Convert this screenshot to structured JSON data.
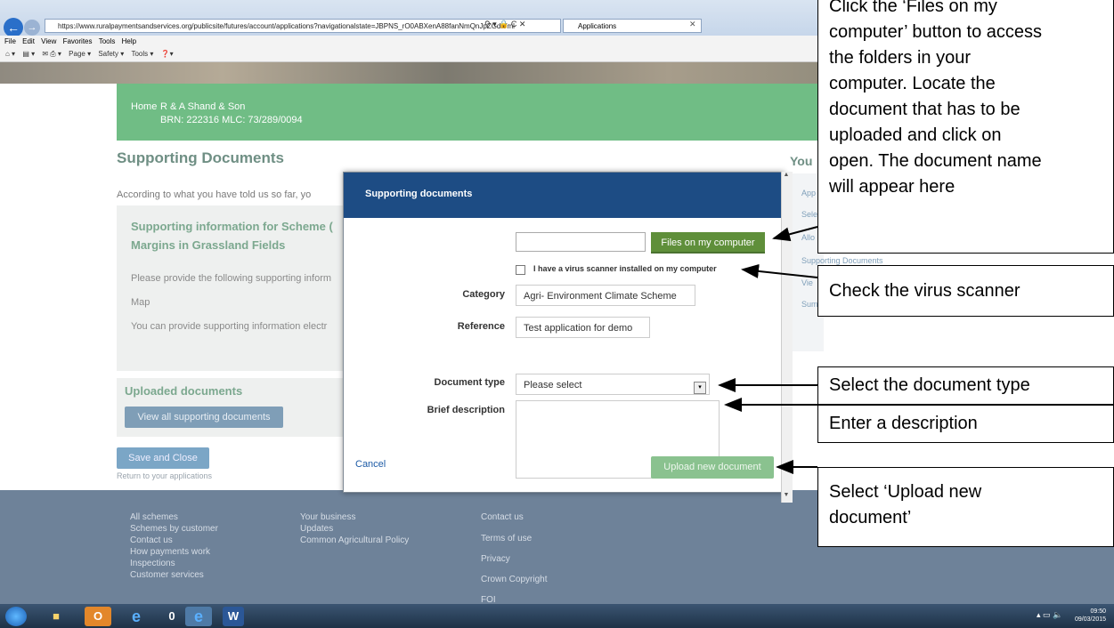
{
  "browser": {
    "url": "https://www.ruralpaymentsandservices.org/publicsite/futures/account/applications?navigationalstate=JBPNS_rO0ABXenA88fanNmQnJpZGdlVml",
    "tab_title": "Applications",
    "menu": [
      "File",
      "Edit",
      "View",
      "Favorites",
      "Tools",
      "Help"
    ],
    "commands": [
      "Page ▾",
      "Safety ▾",
      "Tools ▾"
    ]
  },
  "nav": {
    "home": "Home",
    "company": "R & A Shand & Son",
    "brn": "BRN: 222316 MLC: 73/289/0094"
  },
  "page": {
    "title": "Supporting Documents",
    "intro": "According to what you have told us so far, yo",
    "panel_title": "Supporting information for Scheme (\nMargins in Grassland Fields",
    "panel_p1": "Please provide the following supporting inform",
    "panel_map": "Map",
    "panel_p2": "You can provide supporting information electr",
    "uploaded_title": "Uploaded documents",
    "view_all": "View all supporting documents",
    "save_close": "Save and Close",
    "return": "Return to your applications"
  },
  "sidebar": {
    "title": "You",
    "links": [
      "App",
      "Sele",
      "Allo",
      "Supporting Documents",
      "Vie",
      "Sum"
    ]
  },
  "footer": {
    "col1": [
      "All schemes",
      "Schemes by customer",
      "Contact us",
      "How payments work",
      "Inspections",
      "Customer services"
    ],
    "col2": [
      "Your business",
      "Updates",
      "Common Agricultural Policy"
    ],
    "col3": [
      "Contact us",
      "Terms of use",
      "Privacy",
      "Crown Copyright",
      "FOI"
    ]
  },
  "modal": {
    "title": "Supporting documents",
    "files_button": "Files on my computer",
    "virus_label": "I have a virus scanner installed on my computer",
    "category_label": "Category",
    "category_value": "Agri- Environment Climate Scheme",
    "reference_label": "Reference",
    "reference_value": "Test application for demo",
    "doctype_label": "Document type",
    "doctype_value": "Please select",
    "description_label": "Brief description",
    "cancel": "Cancel",
    "upload": "Upload new document"
  },
  "callouts": {
    "files": "Click the ‘Files on my\ncomputer’ button to access\nthe folders in your\ncomputer. Locate the\ndocument that has to be\nuploaded and click on\nopen. The document name\nwill appear here",
    "virus": "Check the virus scanner",
    "doctype": "Select the document type",
    "description": "Enter a description",
    "upload": "Select ‘Upload  new\ndocument’"
  },
  "taskbar": {
    "time": "09:50",
    "date": "09/03/2015"
  }
}
